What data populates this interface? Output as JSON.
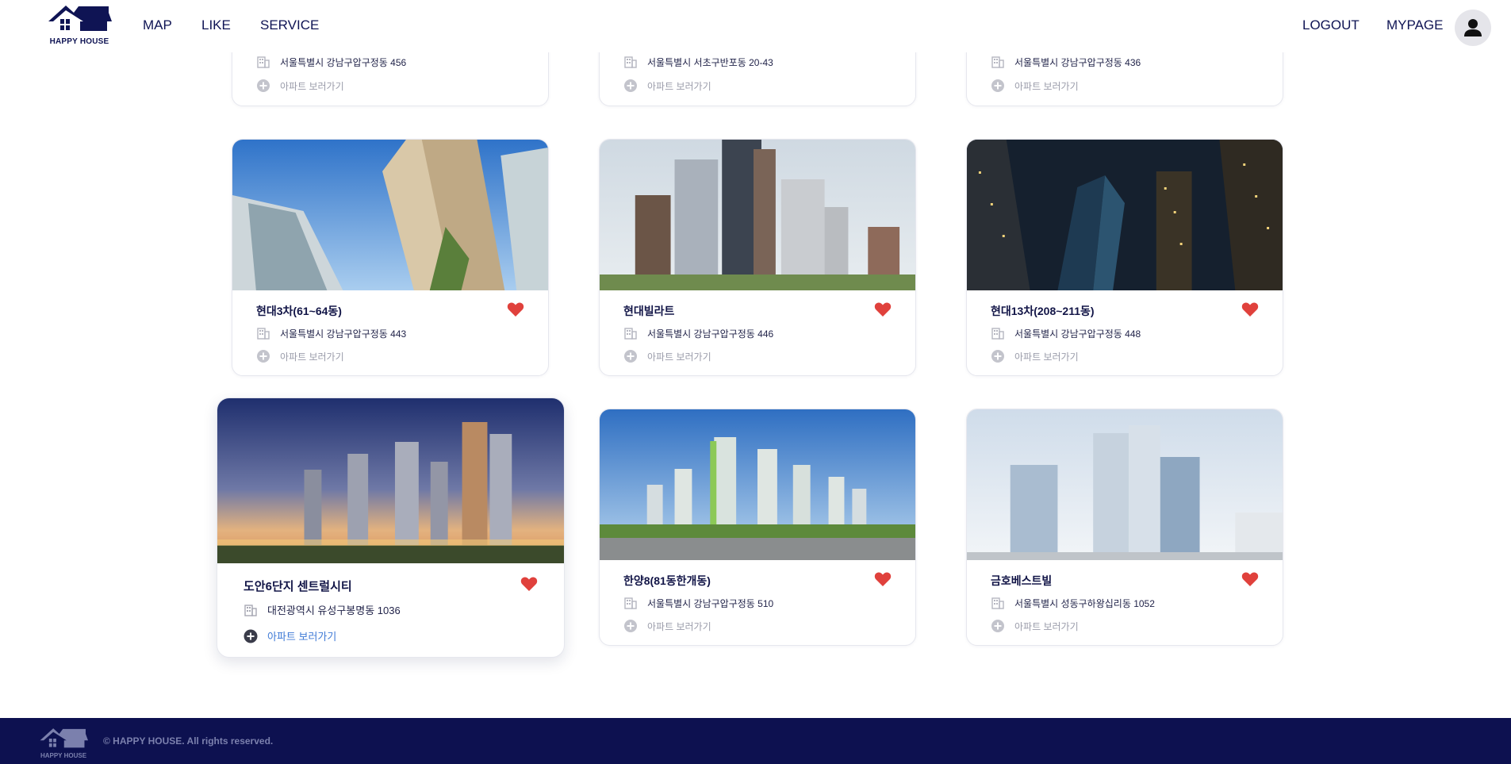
{
  "header": {
    "logo_text": "HAPPY HOUSE",
    "nav": {
      "map": "MAP",
      "like": "LIKE",
      "service": "SERVICE",
      "logout": "LOGOUT",
      "mypage": "MYPAGE"
    }
  },
  "colors": {
    "navy": "#0d1150",
    "heart": "#e0413c",
    "link_blue": "#3f7ad6",
    "muted": "#9a9caa"
  },
  "cards": [
    {
      "title": "",
      "address": "서울특별시 강남구압구정동 456",
      "view_label": "아파트 보러가기",
      "liked": true
    },
    {
      "title": "",
      "address": "서울특별시 서초구반포동 20-43",
      "view_label": "아파트 보러가기",
      "liked": true
    },
    {
      "title": "",
      "address": "서울특별시 강남구압구정동 436",
      "view_label": "아파트 보러가기",
      "liked": true
    },
    {
      "title": "현대3차(61~64동)",
      "address": "서울특별시 강남구압구정동 443",
      "view_label": "아파트 보러가기",
      "liked": true
    },
    {
      "title": "현대빌라트",
      "address": "서울특별시 강남구압구정동 446",
      "view_label": "아파트 보러가기",
      "liked": true
    },
    {
      "title": "현대13차(208~211동)",
      "address": "서울특별시 강남구압구정동 448",
      "view_label": "아파트 보러가기",
      "liked": true
    },
    {
      "title": "도안6단지 센트럴시티",
      "address": "대전광역시 유성구봉명동 1036",
      "view_label": "아파트 보러가기",
      "liked": true,
      "hovered": true
    },
    {
      "title": "한양8(81동한개동)",
      "address": "서울특별시 강남구압구정동 510",
      "view_label": "아파트 보러가기",
      "liked": true
    },
    {
      "title": "금호베스트빌",
      "address": "서울특별시 성동구하왕십리동 1052",
      "view_label": "아파트 보러가기",
      "liked": true
    }
  ],
  "footer": {
    "logo_text": "HAPPY HOUSE",
    "copyright": "© HAPPY HOUSE. All rights reserved."
  },
  "icons": {
    "heart": "heart-icon",
    "building": "building-icon",
    "plus": "plus-circle-icon",
    "user": "user-icon",
    "logo": "house-logo-icon"
  }
}
